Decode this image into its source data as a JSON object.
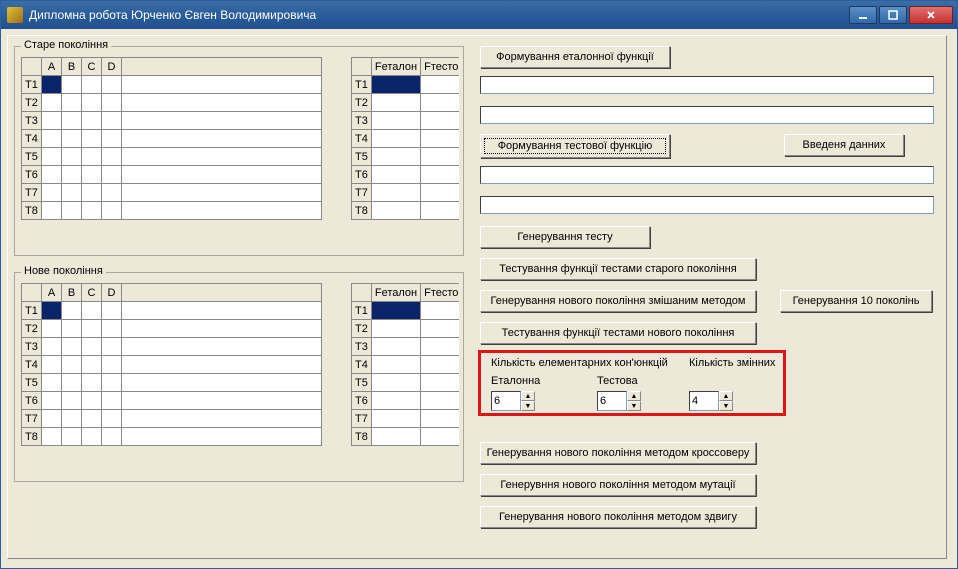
{
  "window": {
    "title": "Дипломна робота Юрченко Євген Володимировича"
  },
  "groups": {
    "old_gen": "Старе покоління",
    "new_gen": "Нове покоління"
  },
  "grid": {
    "cols": [
      "А",
      "B",
      "C",
      "D"
    ],
    "rows": [
      "T1",
      "T2",
      "T3",
      "T4",
      "T5",
      "T6",
      "T7",
      "T8"
    ],
    "cols2": [
      "Fеталон",
      "Fтестов"
    ]
  },
  "buttons": {
    "form_ref_func": "Формування еталонної функції",
    "form_test_func": "Формування тестової функцію",
    "input_data": "Введеня данних",
    "gen_test": "Генерування тесту",
    "test_old_gen": "Тестування функції тестами старого покоління",
    "gen_new_mixed": "Генерування нового покоління змішаним методом",
    "test_new_gen": "Тестування функції тестами нового покоління",
    "gen_10_gens": "Генерування 10 поколінь",
    "gen_new_crossover": "Генерування нового покоління методом кроссоверу",
    "gen_new_mutation": "Генерувння нового покоління методом мутації",
    "gen_new_shift": "Генерування нового покоління методом здвигу"
  },
  "redbox": {
    "heading": "Кількість елементарних кон'юнкцій",
    "variables": "Кількість змінних",
    "ref": "Еталонна",
    "test": "Тестова",
    "val_ref": "6",
    "val_test": "6",
    "val_vars": "4"
  }
}
